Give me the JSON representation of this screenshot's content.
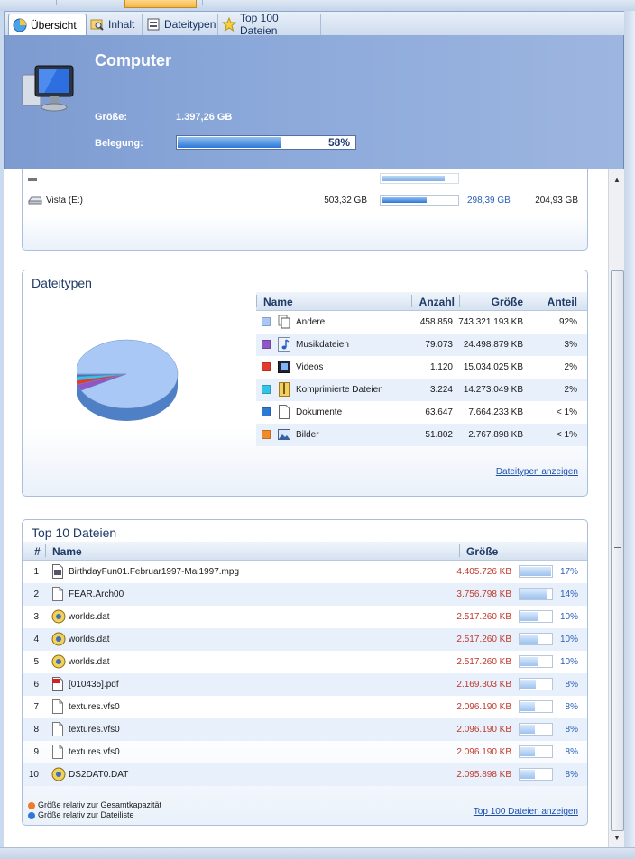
{
  "tabs": [
    {
      "label": "Übersicht",
      "icon": "overview-pie-icon",
      "active": true
    },
    {
      "label": "Inhalt",
      "icon": "folder-search-icon"
    },
    {
      "label": "Dateitypen",
      "icon": "filetypes-icon"
    },
    {
      "label": "Top 100 Dateien",
      "icon": "star-icon"
    }
  ],
  "header": {
    "title": "Computer",
    "size_label": "Größe:",
    "size_value": "1.397,26 GB",
    "usage_label": "Belegung:",
    "usage_pct_text": "58%",
    "usage_fraction": 0.58,
    "icon": "computer-monitor-icon"
  },
  "drives": {
    "rows": [
      {
        "name": "Vista (E:)",
        "total": "503,32 GB",
        "used": "298,39 GB",
        "free": "204,93 GB",
        "fill": 0.59
      }
    ]
  },
  "filetypes": {
    "title": "Dateitypen",
    "columns": {
      "name": "Name",
      "count": "Anzahl",
      "size": "Größe",
      "share": "Anteil"
    },
    "rows": [
      {
        "color": "#a9c8f5",
        "icon": "document-copy-icon",
        "name": "Andere",
        "count": "458.859",
        "size": "743.321.193 KB",
        "share": "92%"
      },
      {
        "color": "#8e57c5",
        "icon": "music-note-icon",
        "name": "Musikdateien",
        "count": "79.073",
        "size": "24.498.879 KB",
        "share": "3%"
      },
      {
        "color": "#e23b2e",
        "icon": "film-strip-icon",
        "name": "Videos",
        "count": "1.120",
        "size": "15.034.025 KB",
        "share": "2%"
      },
      {
        "color": "#35c2e8",
        "icon": "zip-archive-icon",
        "name": "Komprimierte Dateien",
        "count": "3.224",
        "size": "14.273.049 KB",
        "share": "2%"
      },
      {
        "color": "#2f79d6",
        "icon": "document-icon",
        "name": "Dokumente",
        "count": "63.647",
        "size": "7.664.233 KB",
        "share": "< 1%"
      },
      {
        "color": "#f08a2a",
        "icon": "picture-icon",
        "name": "Bilder",
        "count": "51.802",
        "size": "2.767.898 KB",
        "share": "< 1%"
      }
    ],
    "link": "Dateitypen anzeigen"
  },
  "top10": {
    "title": "Top 10 Dateien",
    "columns": {
      "num": "#",
      "name": "Name",
      "size": "Größe"
    },
    "rows": [
      {
        "num": "1",
        "icon": "video-file-icon",
        "name": "BirthdayFun01.Februar1997-Mai1997.mpg",
        "size": "4.405.726 KB",
        "pct": "17%",
        "fill": 1.0
      },
      {
        "num": "2",
        "icon": "blank-file-icon",
        "name": "FEAR.Arch00",
        "size": "3.756.798 KB",
        "pct": "14%",
        "fill": 0.85
      },
      {
        "num": "3",
        "icon": "dat-file-icon",
        "name": "worlds.dat",
        "size": "2.517.260 KB",
        "pct": "10%",
        "fill": 0.57
      },
      {
        "num": "4",
        "icon": "dat-file-icon",
        "name": "worlds.dat",
        "size": "2.517.260 KB",
        "pct": "10%",
        "fill": 0.57
      },
      {
        "num": "5",
        "icon": "dat-file-icon",
        "name": "worlds.dat",
        "size": "2.517.260 KB",
        "pct": "10%",
        "fill": 0.57
      },
      {
        "num": "6",
        "icon": "pdf-file-icon",
        "name": "[010435].pdf",
        "size": "2.169.303 KB",
        "pct": "8%",
        "fill": 0.49
      },
      {
        "num": "7",
        "icon": "blank-file-icon",
        "name": "textures.vfs0",
        "size": "2.096.190 KB",
        "pct": "8%",
        "fill": 0.48
      },
      {
        "num": "8",
        "icon": "blank-file-icon",
        "name": "textures.vfs0",
        "size": "2.096.190 KB",
        "pct": "8%",
        "fill": 0.48
      },
      {
        "num": "9",
        "icon": "blank-file-icon",
        "name": "textures.vfs0",
        "size": "2.096.190 KB",
        "pct": "8%",
        "fill": 0.48
      },
      {
        "num": "10",
        "icon": "dat-file-icon",
        "name": "DS2DAT0.DAT",
        "size": "2.095.898 KB",
        "pct": "8%",
        "fill": 0.48
      }
    ],
    "legend_capacity": "Größe relativ zur Gesamtkapazität",
    "legend_list": "Größe relativ zur Dateiliste",
    "legend_capacity_color": "#f07a2a",
    "legend_list_color": "#2f79d6",
    "link": "Top 100 Dateien anzeigen"
  },
  "chart_data": {
    "type": "pie",
    "categories": [
      "Andere",
      "Musikdateien",
      "Videos",
      "Komprimierte Dateien",
      "Dokumente",
      "Bilder"
    ],
    "values": [
      743321193,
      24498879,
      15034025,
      14273049,
      7664233,
      2767898
    ]
  }
}
